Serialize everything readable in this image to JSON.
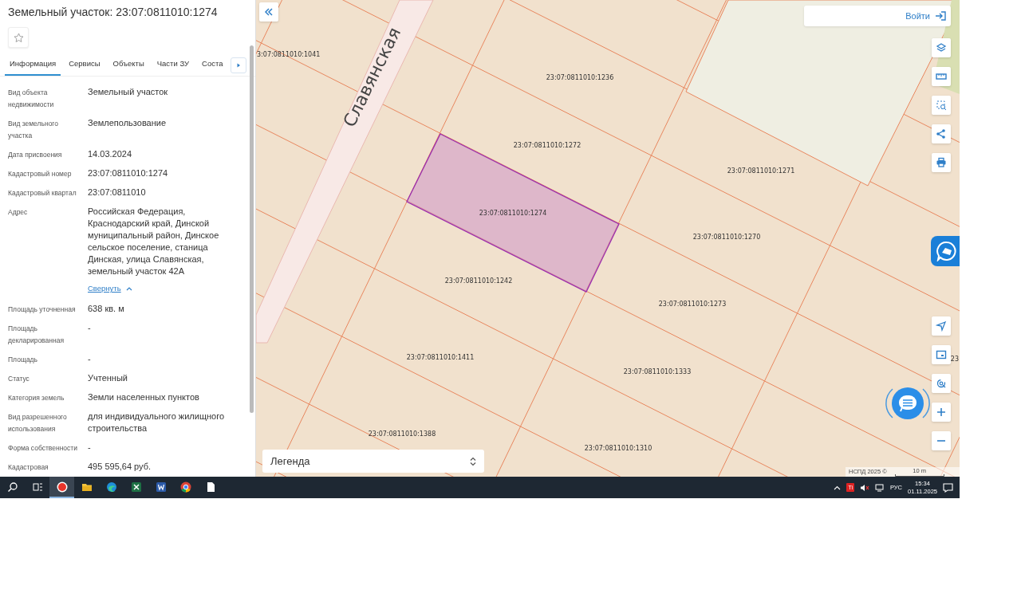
{
  "panel": {
    "title": "Земельный участок: 23:07:0811010:1274",
    "favorite": {
      "checked": false
    },
    "tabs": [
      {
        "label": "Информация",
        "selected": true
      },
      {
        "label": "Сервисы",
        "selected": false
      },
      {
        "label": "Объекты",
        "selected": false
      },
      {
        "label": "Части ЗУ",
        "selected": false
      },
      {
        "label": "Соста",
        "selected": false
      }
    ],
    "fields": [
      {
        "label": "Вид объекта недвижимости",
        "value": "Земельный участок"
      },
      {
        "label": "Вид земельного участка",
        "value": "Землепользование"
      },
      {
        "label": "Дата присвоения",
        "value": "14.03.2024"
      },
      {
        "label": "Кадастровый номер",
        "value": "23:07:0811010:1274"
      },
      {
        "label": "Кадастровый квартал",
        "value": "23:07:0811010"
      },
      {
        "label": "Адрес",
        "value": "Российская Федерация, Краснодарский край, Динской муниципальный район, Динское сельское поселение, станица Динская, улица Славянская, земельный участок 42А",
        "toggle": {
          "label": "Свернуть",
          "expanded": true
        }
      },
      {
        "label": "Площадь уточненная",
        "value": "638 кв. м"
      },
      {
        "label": "Площадь декларированная",
        "value": "-"
      },
      {
        "label": "Площадь",
        "value": "-"
      },
      {
        "label": "Статус",
        "value": "Учтенный"
      },
      {
        "label": "Категория земель",
        "value": "Земли населенных пунктов"
      },
      {
        "label": "Вид разрешенного использования",
        "value": "для индивидуального жилищного строительства"
      },
      {
        "label": "Форма собственности",
        "value": "-"
      },
      {
        "label": "Кадастровая",
        "value": "495 595,64 руб."
      }
    ]
  },
  "map": {
    "street": "Славянская",
    "parcels": [
      {
        "label": "3:07:0811010:1041",
        "selected": false
      },
      {
        "label": "23:07:0811010:1236",
        "selected": false
      },
      {
        "label": "23:07:0811010:1272",
        "selected": false
      },
      {
        "label": "23:07:0811010:1271",
        "selected": false
      },
      {
        "label": "23:07:0811010:1274",
        "selected": true
      },
      {
        "label": "23:07:0811010:1270",
        "selected": false
      },
      {
        "label": "23:07:0811010:1242",
        "selected": false
      },
      {
        "label": "23:07:0811010:1273",
        "selected": false
      },
      {
        "label": "23:07:0811010:1411",
        "selected": false
      },
      {
        "label": "23",
        "selected": false
      },
      {
        "label": "23:07:0811010:1333",
        "selected": false
      },
      {
        "label": "23:07:0811010:1388",
        "selected": false
      },
      {
        "label": "23:07:0811010:1310",
        "selected": false
      }
    ],
    "login": "Войти",
    "legend": "Легенда",
    "attribution": "НСПД 2025 ©",
    "scale": "10 m"
  },
  "taskbar": {
    "apps": [
      {
        "kind": "search",
        "selected": false
      },
      {
        "kind": "taskview",
        "selected": false
      },
      {
        "kind": "yandex",
        "selected": true
      },
      {
        "kind": "explorer",
        "selected": false
      },
      {
        "kind": "edge",
        "selected": false
      },
      {
        "kind": "excel",
        "selected": false
      },
      {
        "kind": "word",
        "selected": false
      },
      {
        "kind": "chrome",
        "selected": false
      },
      {
        "kind": "file",
        "selected": false
      }
    ],
    "tray": {
      "badge": "Ti",
      "language": "РУС",
      "time": "15:34",
      "date": "01.11.2025"
    }
  }
}
